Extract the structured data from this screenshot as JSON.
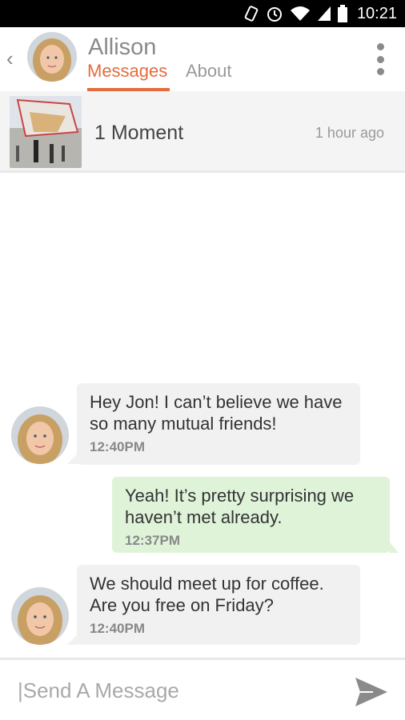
{
  "status_bar": {
    "time": "10:21"
  },
  "header": {
    "contact_name": "Allison",
    "tabs": [
      {
        "label": "Messages",
        "active": true
      },
      {
        "label": "About",
        "active": false
      }
    ]
  },
  "moment": {
    "title": "1 Moment",
    "time": "1 hour ago"
  },
  "messages": [
    {
      "from": "them",
      "text": "Hey Jon! I can’t believe we have so many mutual friends!",
      "time": "12:40PM"
    },
    {
      "from": "me",
      "text": "Yeah! It’s pretty surprising we haven’t met already.",
      "time": "12:37PM"
    },
    {
      "from": "them",
      "text": "We should meet up for coffee. Are you free on Friday?",
      "time": "12:40PM"
    }
  ],
  "composer": {
    "placeholder": "|Send A Message"
  },
  "colors": {
    "accent": "#e46c3c",
    "incoming_bubble": "#f1f1f1",
    "outgoing_bubble": "#dff3d9"
  }
}
